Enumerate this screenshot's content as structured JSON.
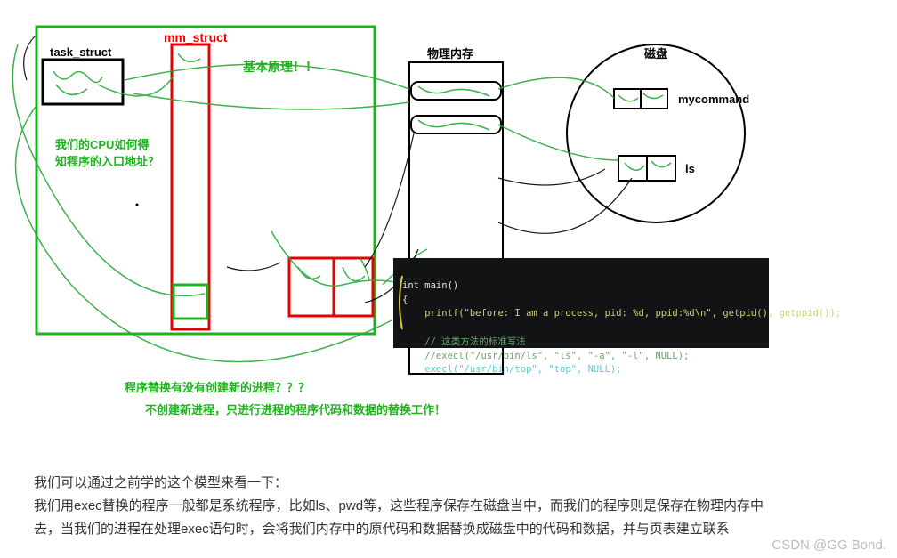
{
  "labels": {
    "task_struct": "task_struct",
    "mm_struct": "mm_struct",
    "physmem": "物理内存",
    "disk": "磁盘",
    "mycommand": "mycommand",
    "ls": "ls",
    "principle": "基本原理！！",
    "cpu_q1": "我们的CPU如何得",
    "cpu_q2": "知程序的入口地址？",
    "replace_q": "程序替换有没有创建新的进程？？？",
    "replace_a": "不创建新进程，只进行进程的程序代码和数据的替换工作！"
  },
  "code": {
    "l1": "int main()",
    "l2": "{",
    "l3": "    printf(\"before: I am a process, pid: %d, ppid:%d\\n\", getpid(), getppid());",
    "c1": "    // 这类方法的标准写法",
    "c2": "    //execl(\"/usr/bin/ls\", \"ls\", \"-a\", \"-l\", NULL);",
    "l4": "    execl(\"/usr/bin/top\", \"top\", NULL);"
  },
  "para": {
    "p1": "我们可以通过之前学的这个模型来看一下：",
    "p2": "我们用exec替换的程序一般都是系统程序，比如ls、pwd等，这些程序保存在磁盘当中，而我们的程序则是保存在物理内存中",
    "p3": "去，当我们的进程在处理exec语句时，会将我们内存中的原代码和数据替换成磁盘中的代码和数据，并与页表建立联系"
  },
  "watermark": "CSDN @GG Bond."
}
